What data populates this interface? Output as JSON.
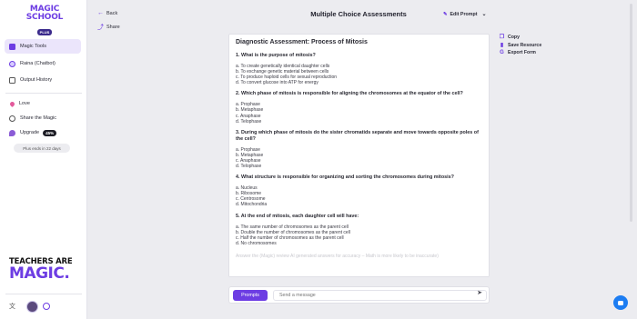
{
  "brand": {
    "logo_line1": "MAGIC",
    "logo_line2": "SCHOOL",
    "logo_badge": "PLUS"
  },
  "sidebar": {
    "items": [
      {
        "label": "Magic Tools",
        "icon": "wand-icon",
        "active": true
      },
      {
        "label": "Raina (Chatbot)",
        "icon": "chatbot-icon",
        "active": false
      },
      {
        "label": "Output History",
        "icon": "history-icon",
        "active": false
      }
    ],
    "secondary": [
      {
        "label": "Love",
        "icon": "heart-icon"
      },
      {
        "label": "Share the Magic",
        "icon": "share-icon"
      },
      {
        "label": "Upgrade",
        "icon": "upgrade-icon",
        "badge": "45%"
      }
    ],
    "plus_ends": "Plus ends in 22 days",
    "banner_line1": "TEACHERS ARE",
    "banner_line2": "MAGIC."
  },
  "header": {
    "back": "Back",
    "share": "Share",
    "title": "Multiple Choice Assessments",
    "edit_prompt": "Edit Prompt"
  },
  "document": {
    "title": "Diagnostic Assessment: Process of Mitosis",
    "questions": [
      {
        "text": "1. What is the purpose of mitosis?",
        "options": [
          "a. To create genetically identical daughter cells",
          "b. To exchange genetic material between cells",
          "c. To produce haploid cells for sexual reproduction",
          "d. To convert glucose into ATP for energy"
        ]
      },
      {
        "text": "2. Which phase of mitosis is responsible for aligning the chromosomes at the equator of the cell?",
        "options": [
          "a. Prophase",
          "b. Metaphase",
          "c. Anaphase",
          "d. Telophase"
        ]
      },
      {
        "text": "3. During which phase of mitosis do the sister chromatids separate and move towards opposite poles of the cell?",
        "options": [
          "a. Prophase",
          "b. Metaphase",
          "c. Anaphase",
          "d. Telophase"
        ]
      },
      {
        "text": "4. What structure is responsible for organizing and sorting the chromosomes during mitosis?",
        "options": [
          "a. Nucleus",
          "b. Ribosome",
          "c. Centrosome",
          "d. Mitochondria"
        ]
      },
      {
        "text": "5. At the end of mitosis, each daughter cell will have:",
        "options": [
          "a. The same number of chromosomes as the parent cell",
          "b. Double the number of chromosomes as the parent cell",
          "c. Half the number of chromosomes as the parent cell",
          "d. No chromosomes"
        ]
      }
    ],
    "faded_note": "Answer the (Magic) review AI generated answers for accuracy – Math is more likely to be inaccurate)"
  },
  "actions": {
    "copy": "Copy",
    "save_resource": "Save Resource",
    "export_form": "Export Form"
  },
  "prompt_bar": {
    "button": "Prompts",
    "placeholder": "Send a message"
  },
  "colors": {
    "accent": "#6d3de3",
    "help": "#1d7df2"
  }
}
